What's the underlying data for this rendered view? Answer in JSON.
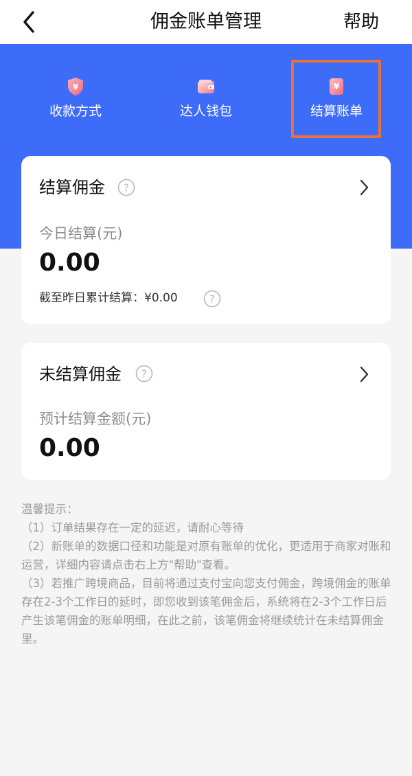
{
  "header": {
    "title": "佣金账单管理",
    "help_label": "帮助"
  },
  "tabs": [
    {
      "label": "收款方式",
      "icon": "shield-yen-icon"
    },
    {
      "label": "达人钱包",
      "icon": "wallet-icon"
    },
    {
      "label": "结算账单",
      "icon": "yen-bill-icon",
      "highlighted": true
    }
  ],
  "settled_card": {
    "title": "结算佣金",
    "today_label": "今日结算(元)",
    "today_amount": "0.00",
    "cumulative_note": "截至昨日累计结算：¥0.00"
  },
  "unsettled_card": {
    "title": "未结算佣金",
    "estimate_label": "预计结算金额(元)",
    "estimate_amount": "0.00"
  },
  "tips": {
    "heading": "温馨提示：",
    "items": [
      "（1）订单结果存在一定的延迟，请耐心等待",
      "（2）新账单的数据口径和功能是对原有账单的优化，更适用于商家对账和运营，详细内容请点击右上方\"帮助\"查看。",
      "（3）若推广跨境商品，目前将通过支付宝向您支付佣金，跨境佣金的账单存在2-3个工作日的延时，即您收到该笔佣金后，系统将在2-3个工作日后产生该笔佣金的账单明细，在此之前，该笔佣金将继续统计在未结算佣金里。"
    ]
  },
  "colors": {
    "brand_blue": "#3d6cf9",
    "highlight_orange": "#e8703a",
    "icon_pink": "#f47f8e"
  }
}
